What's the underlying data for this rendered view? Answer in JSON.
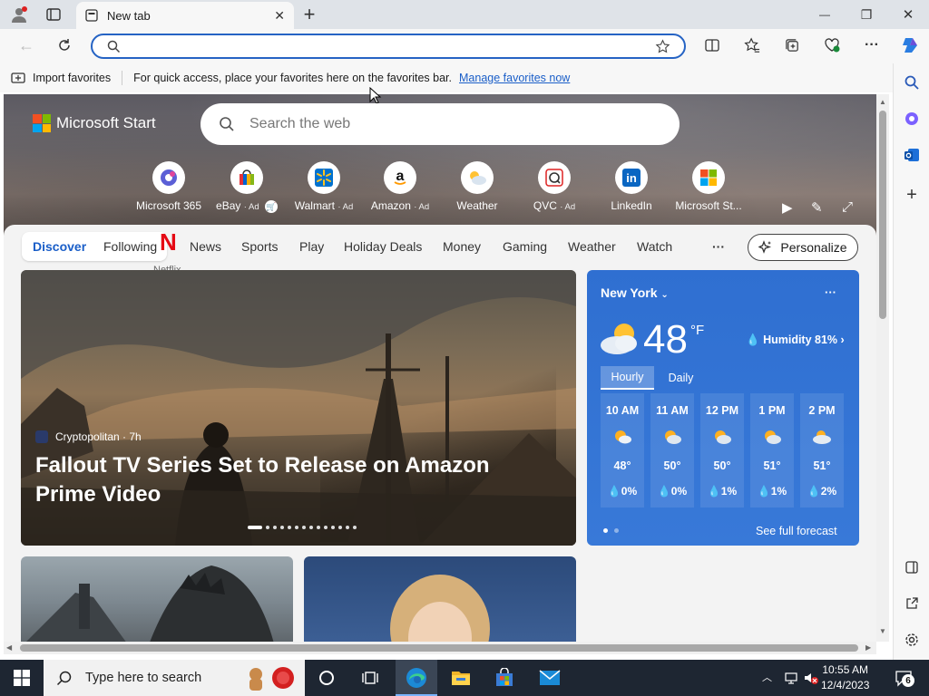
{
  "browser": {
    "tab_title": "New tab",
    "tab_close": "✕",
    "new_tab": "+",
    "window_min": "—",
    "window_max": "❐",
    "window_close": "✕"
  },
  "favorites_bar": {
    "import_label": "Import favorites",
    "message": "For quick access, place your favorites here on the favorites bar.",
    "manage_link": "Manage favorites now"
  },
  "page": {
    "brand": "Microsoft Start",
    "search_placeholder": "Search the web",
    "quick_links": [
      {
        "label": "Microsoft 365",
        "ad": ""
      },
      {
        "label": "eBay",
        "ad": "· Ad"
      },
      {
        "label": "Walmart",
        "ad": "· Ad"
      },
      {
        "label": "Amazon",
        "ad": "· Ad"
      },
      {
        "label": "Weather",
        "ad": ""
      },
      {
        "label": "QVC",
        "ad": "· Ad"
      },
      {
        "label": "LinkedIn",
        "ad": ""
      },
      {
        "label": "Microsoft St...",
        "ad": ""
      }
    ],
    "nav": {
      "discover": "Discover",
      "following": "Following",
      "items": [
        "News",
        "Sports",
        "Play",
        "Holiday Deals",
        "Money",
        "Gaming",
        "Weather",
        "Watch"
      ],
      "more": "···",
      "personalize": "Personalize",
      "netflix_letter": "N",
      "netflix_label": "Netflix"
    },
    "headline": {
      "source": "Cryptopolitan · 7h",
      "title": "Fallout TV Series Set to Release on Amazon Prime Video"
    },
    "weather": {
      "city": "New York",
      "temp": "48",
      "unit": "°F",
      "humidity": "Humidity 81%",
      "tabs": [
        "Hourly",
        "Daily"
      ],
      "hours": [
        {
          "time": "10 AM",
          "temp": "48°",
          "precip": "0%"
        },
        {
          "time": "11 AM",
          "temp": "50°",
          "precip": "0%"
        },
        {
          "time": "12 PM",
          "temp": "50°",
          "precip": "1%"
        },
        {
          "time": "1 PM",
          "temp": "51°",
          "precip": "1%"
        },
        {
          "time": "2 PM",
          "temp": "51°",
          "precip": "2%"
        }
      ],
      "forecast_link": "See full forecast",
      "more": "···"
    }
  },
  "taskbar": {
    "search_placeholder": "Type here to search",
    "time": "10:55 AM",
    "date": "12/4/2023",
    "notifications": "6"
  }
}
